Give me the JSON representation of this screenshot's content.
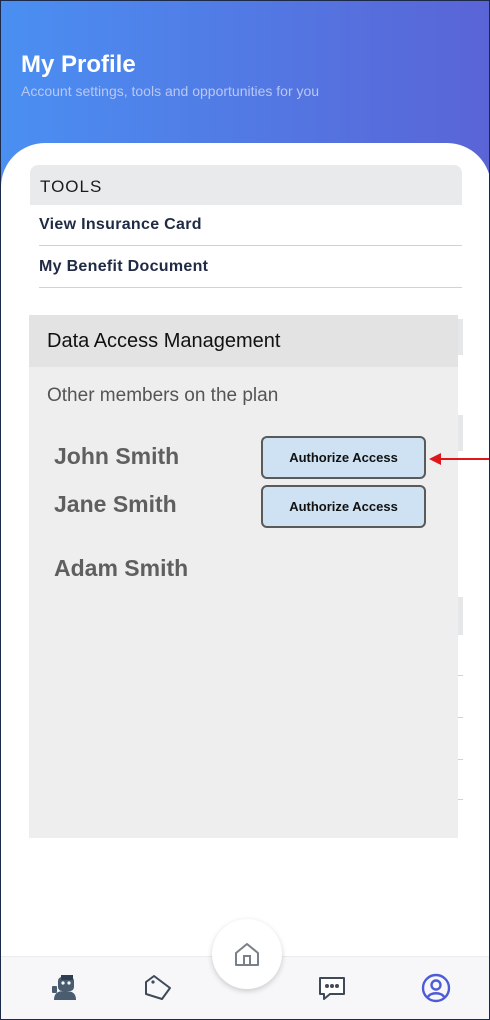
{
  "header": {
    "title": "My Profile",
    "subtitle": "Account settings, tools and opportunities for you"
  },
  "tools": {
    "section_label": "TOOLS",
    "links": [
      "View Insurance Card",
      "My Benefit Document"
    ]
  },
  "modal": {
    "title": "Data Access Management",
    "subtitle": "Other members on the plan",
    "members": [
      {
        "name": "John Smith",
        "button_label": "Authorize Access"
      },
      {
        "name": "Jane Smith",
        "button_label": "Authorize Access"
      },
      {
        "name": "Adam Smith"
      }
    ]
  },
  "nav": {
    "items": [
      "doctor-icon",
      "tag-icon",
      "home-icon",
      "chat-icon",
      "profile-icon"
    ]
  },
  "colors": {
    "header_start": "#4a8ff2",
    "header_end": "#5a64d6",
    "button_fill": "#cfe2f3",
    "accent_nav": "#4d5bd6",
    "annotation_arrow": "#e0161b"
  }
}
